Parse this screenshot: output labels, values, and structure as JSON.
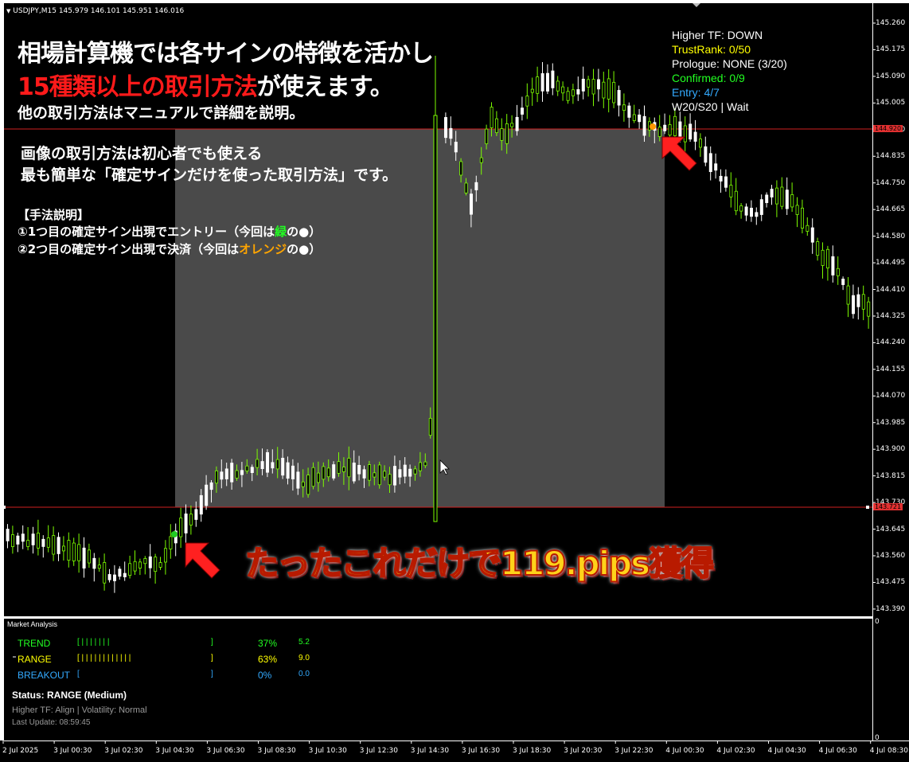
{
  "header": {
    "symbol_line": "USDJPY,M15  145.979 146.101 145.951 146.016"
  },
  "promo": {
    "line1": "相場計算機では各サインの特徴を活かし",
    "line2_red": "15種類以上の取引方法",
    "line2_white": "が使えます。",
    "line3": "他の取引方法はマニュアルで詳細を説明。",
    "line4": "画像の取引方法は初心者でも使える",
    "line5": "最も簡単な「確定サインだけを使った取引方法」です。",
    "method_title": "【手法説明】",
    "step1_a": "①1つ目の確定サイン出現でエントリー（今回は",
    "step1_color": "緑",
    "step1_b": "の●）",
    "step2_a": "②2つ目の確定サイン出現で決済（今回は",
    "step2_color": "オレンジ",
    "step2_b": "の●）",
    "banner": "たったこれだけで119.pips獲得"
  },
  "info_panel": {
    "higher_tf": "Higher TF: DOWN",
    "trust_rank": "TrustRank: 0/50",
    "prologue": "Prologue: NONE (3/20)",
    "confirmed": "Confirmed: 0/9",
    "entry": "Entry: 4/7",
    "w_s": "W20/S20 | Wait"
  },
  "price_axis": [
    "145.260",
    "145.175",
    "145.090",
    "145.005",
    "144.920",
    "144.835",
    "144.750",
    "144.665",
    "144.580",
    "144.495",
    "144.410",
    "144.325",
    "144.240",
    "144.155",
    "144.070",
    "143.985",
    "143.900",
    "143.815",
    "143.730",
    "143.645",
    "143.560",
    "143.475",
    "143.390"
  ],
  "price_tags": {
    "upper": "144.920",
    "lower": "143.721"
  },
  "market_analysis": {
    "title": "Market Analysis",
    "rows": [
      {
        "name": "TREND",
        "bar": "[ | | | | | | |",
        "close": "]",
        "pct": "37%",
        "val": "5.2"
      },
      {
        "name": "RANGE",
        "bar": "[ | | | | | | | | | | | |",
        "close": "]",
        "pct": "63%",
        "val": "9.0"
      },
      {
        "name": "BREAKOUT",
        "bar": "[",
        "close": "]",
        "pct": "0%",
        "val": "0.0"
      }
    ],
    "status": "Status: RANGE (Medium)",
    "higher_tf": "Higher TF: Align | Volatility: Normal",
    "last_update": "Last Update: 08:59:45",
    "axis_top": "0",
    "axis_bottom": "0"
  },
  "date_axis": [
    "2 Jul 2025",
    "3 Jul 00:30",
    "3 Jul 02:30",
    "3 Jul 04:30",
    "3 Jul 06:30",
    "3 Jul 08:30",
    "3 Jul 10:30",
    "3 Jul 12:30",
    "3 Jul 14:30",
    "3 Jul 16:30",
    "3 Jul 18:30",
    "3 Jul 20:30",
    "3 Jul 22:30",
    "4 Jul 00:30",
    "4 Jul 02:30",
    "4 Jul 04:30",
    "4 Jul 06:30",
    "4 Jul 08:30"
  ],
  "colors": {
    "background": "#000000",
    "bull": "#ffffff",
    "bear": "#7cfc00",
    "level_line": "#d02020",
    "highlight_zone": "#4a4a4a",
    "entry_dot": "#22cc22",
    "exit_dot": "#ff9900",
    "trend": "#22ff22",
    "range": "#ffff00",
    "breakout": "#33aaff",
    "trustrank": "#ffff00",
    "confirmed": "#22ff22",
    "entry": "#33aaff",
    "red_text": "#ff1a1a",
    "green_text": "#22ff22",
    "orange_text": "#ffa500"
  },
  "icons": {
    "arrow1": "red-arrow-icon",
    "arrow2": "red-arrow-icon",
    "cursor": "mouse-cursor-icon",
    "collapse": "chevron-down-icon"
  }
}
